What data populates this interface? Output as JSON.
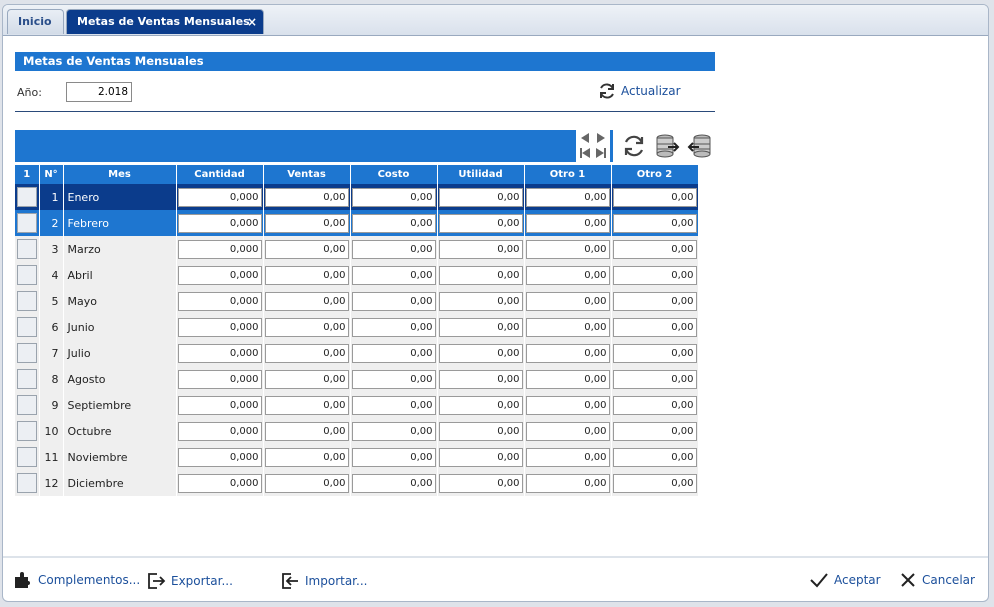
{
  "tabs": [
    {
      "label": "Inicio"
    },
    {
      "label": "Metas de Ventas Mensuales",
      "close": "×"
    }
  ],
  "panel": {
    "title": "Metas de Ventas Mensuales"
  },
  "year": {
    "label": "Año:",
    "value": "2.018"
  },
  "actualizar_label": "Actualizar",
  "table": {
    "headers": [
      "1",
      "N°",
      "Mes",
      "Cantidad",
      "Ventas",
      "Costo",
      "Utilidad",
      "Otro 1",
      "Otro 2"
    ],
    "rows": [
      {
        "n": "1",
        "mes": "Enero",
        "cantidad": "0,000",
        "ventas": "0,00",
        "costo": "0,00",
        "utilidad": "0,00",
        "otro1": "0,00",
        "otro2": "0,00"
      },
      {
        "n": "2",
        "mes": "Febrero",
        "cantidad": "0,000",
        "ventas": "0,00",
        "costo": "0,00",
        "utilidad": "0,00",
        "otro1": "0,00",
        "otro2": "0,00"
      },
      {
        "n": "3",
        "mes": "Marzo",
        "cantidad": "0,000",
        "ventas": "0,00",
        "costo": "0,00",
        "utilidad": "0,00",
        "otro1": "0,00",
        "otro2": "0,00"
      },
      {
        "n": "4",
        "mes": "Abril",
        "cantidad": "0,000",
        "ventas": "0,00",
        "costo": "0,00",
        "utilidad": "0,00",
        "otro1": "0,00",
        "otro2": "0,00"
      },
      {
        "n": "5",
        "mes": "Mayo",
        "cantidad": "0,000",
        "ventas": "0,00",
        "costo": "0,00",
        "utilidad": "0,00",
        "otro1": "0,00",
        "otro2": "0,00"
      },
      {
        "n": "6",
        "mes": "Junio",
        "cantidad": "0,000",
        "ventas": "0,00",
        "costo": "0,00",
        "utilidad": "0,00",
        "otro1": "0,00",
        "otro2": "0,00"
      },
      {
        "n": "7",
        "mes": "Julio",
        "cantidad": "0,000",
        "ventas": "0,00",
        "costo": "0,00",
        "utilidad": "0,00",
        "otro1": "0,00",
        "otro2": "0,00"
      },
      {
        "n": "8",
        "mes": "Agosto",
        "cantidad": "0,000",
        "ventas": "0,00",
        "costo": "0,00",
        "utilidad": "0,00",
        "otro1": "0,00",
        "otro2": "0,00"
      },
      {
        "n": "9",
        "mes": "Septiembre",
        "cantidad": "0,000",
        "ventas": "0,00",
        "costo": "0,00",
        "utilidad": "0,00",
        "otro1": "0,00",
        "otro2": "0,00"
      },
      {
        "n": "10",
        "mes": "Octubre",
        "cantidad": "0,000",
        "ventas": "0,00",
        "costo": "0,00",
        "utilidad": "0,00",
        "otro1": "0,00",
        "otro2": "0,00"
      },
      {
        "n": "11",
        "mes": "Noviembre",
        "cantidad": "0,000",
        "ventas": "0,00",
        "costo": "0,00",
        "utilidad": "0,00",
        "otro1": "0,00",
        "otro2": "0,00"
      },
      {
        "n": "12",
        "mes": "Diciembre",
        "cantidad": "0,000",
        "ventas": "0,00",
        "costo": "0,00",
        "utilidad": "0,00",
        "otro1": "0,00",
        "otro2": "0,00"
      }
    ]
  },
  "footer": {
    "complementos": "Complementos...",
    "exportar": "Exportar...",
    "importar": "Importar...",
    "aceptar": "Aceptar",
    "cancelar": "Cancelar"
  },
  "colors": {
    "accent": "#1e76d0",
    "active_row": "#0b3c8c",
    "link": "#1b4f9b"
  },
  "icons": [
    "refresh-icon",
    "first-page-icon",
    "prev-page-icon",
    "next-page-icon",
    "last-page-icon",
    "database-export-icon",
    "database-import-icon",
    "puzzle-icon",
    "export-icon",
    "import-icon",
    "check-icon",
    "close-icon"
  ]
}
